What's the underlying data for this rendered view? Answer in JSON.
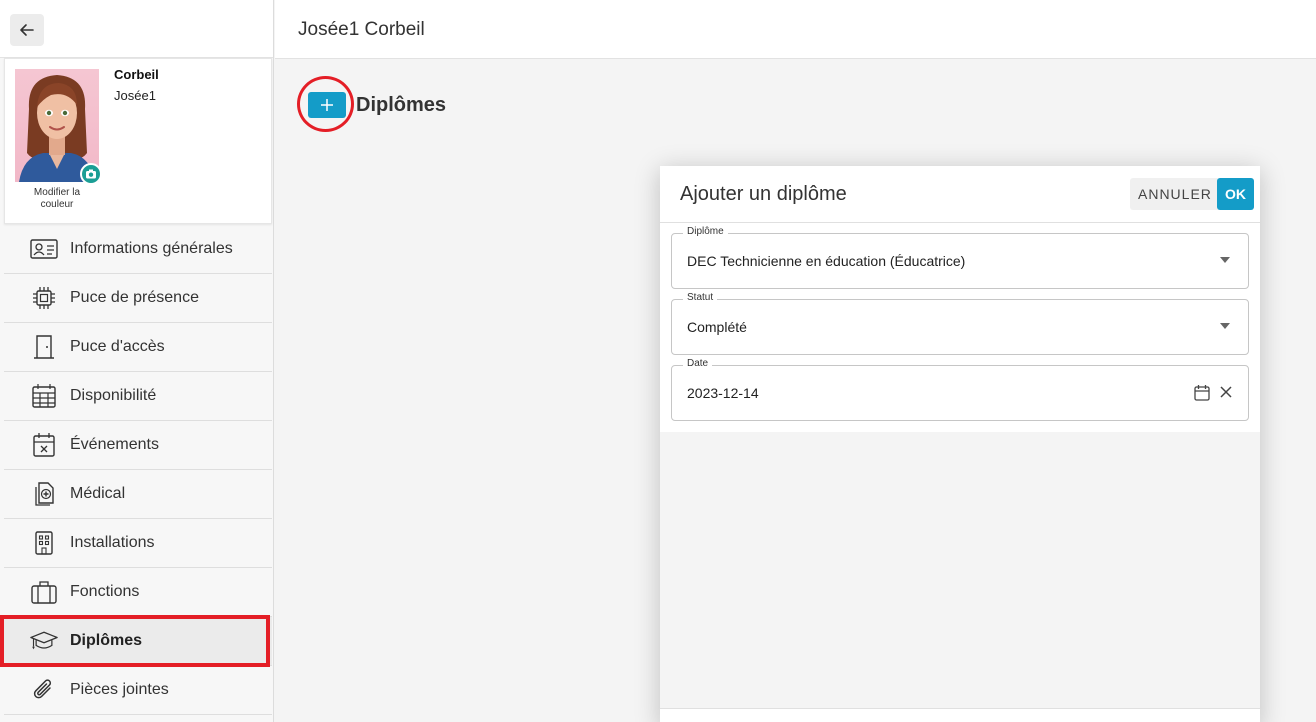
{
  "header": {
    "title": "Josée1 Corbeil"
  },
  "profile": {
    "last_name": "Corbeil",
    "first_name": "Josée1",
    "modify_color_label": "Modifier la couleur"
  },
  "sidebar": {
    "items": [
      {
        "label": "Informations générales",
        "icon": "id-card-icon"
      },
      {
        "label": "Puce de présence",
        "icon": "chip-icon"
      },
      {
        "label": "Puce d'accès",
        "icon": "door-icon"
      },
      {
        "label": "Disponibilité",
        "icon": "calendar-grid-icon"
      },
      {
        "label": "Événements",
        "icon": "calendar-x-icon"
      },
      {
        "label": "Médical",
        "icon": "medical-icon"
      },
      {
        "label": "Installations",
        "icon": "building-icon"
      },
      {
        "label": "Fonctions",
        "icon": "briefcase-icon"
      },
      {
        "label": "Diplômes",
        "icon": "graduation-cap-icon",
        "active": true
      },
      {
        "label": "Pièces jointes",
        "icon": "paperclip-icon"
      }
    ]
  },
  "section": {
    "title": "Diplômes",
    "add_icon": "plus-icon"
  },
  "dialog": {
    "title": "Ajouter un diplôme",
    "cancel_label": "ANNULER",
    "ok_label": "OK",
    "fields": {
      "diplome": {
        "label": "Diplôme",
        "value": "DEC Technicienne en éducation (Éducatrice)"
      },
      "statut": {
        "label": "Statut",
        "value": "Complété"
      },
      "date": {
        "label": "Date",
        "value": "2023-12-14"
      }
    }
  },
  "colors": {
    "accent": "#149cc8",
    "highlight": "#e41e26",
    "camera": "#1b9e95"
  }
}
